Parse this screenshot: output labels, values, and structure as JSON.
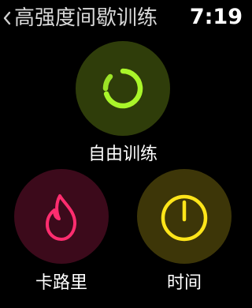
{
  "header": {
    "back_icon": "chevron-left-icon",
    "title": "高强度间歇训练",
    "time": "7:19"
  },
  "tiles": [
    {
      "label": "自由训练",
      "icon": "open-goal-ring-icon",
      "background": "#2f3d0a",
      "accent": "#a9f52a"
    },
    {
      "label": "卡路里",
      "icon": "flame-icon",
      "background": "#3c0a1b",
      "accent": "#ff2d6f"
    },
    {
      "label": "时间",
      "icon": "stopwatch-icon",
      "background": "#3d3608",
      "accent": "#ffe51a"
    }
  ]
}
